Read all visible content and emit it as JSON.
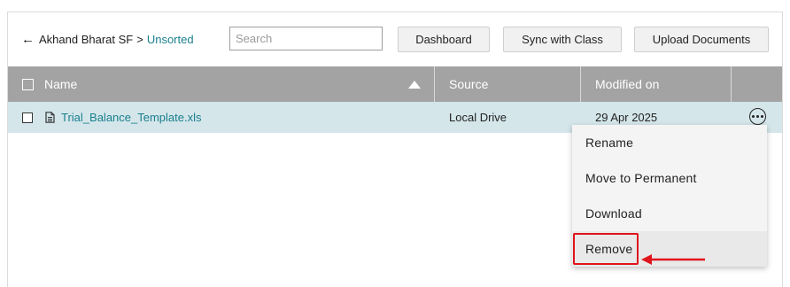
{
  "breadcrumb": {
    "back_icon": "arrow-left-icon",
    "parent": "Akhand Bharat SF",
    "separator": ">",
    "current": "Unsorted"
  },
  "search": {
    "placeholder": "Search",
    "value": ""
  },
  "toolbar": {
    "dashboard_label": "Dashboard",
    "sync_label": "Sync with Class",
    "upload_label": "Upload Documents"
  },
  "table": {
    "columns": [
      "Name",
      "Source",
      "Modified on"
    ],
    "sort": {
      "column": "Name",
      "direction": "ascending",
      "icon": "sort-up-icon"
    },
    "rows": [
      {
        "name": "Trial_Balance_Template.xls",
        "icon": "document-icon",
        "source": "Local Drive",
        "modified": "29 Apr 2025",
        "selected": false,
        "actions_icon": "more-horizontal-icon"
      }
    ]
  },
  "context_menu": {
    "items": [
      "Rename",
      "Move to Permanent",
      "Download",
      "Remove"
    ],
    "highlighted": "Remove"
  },
  "colors": {
    "header_bg": "#a3a3a3",
    "row_bg": "#d4e6ea",
    "link": "#1a7f8e",
    "annotation": "#e0141c"
  }
}
